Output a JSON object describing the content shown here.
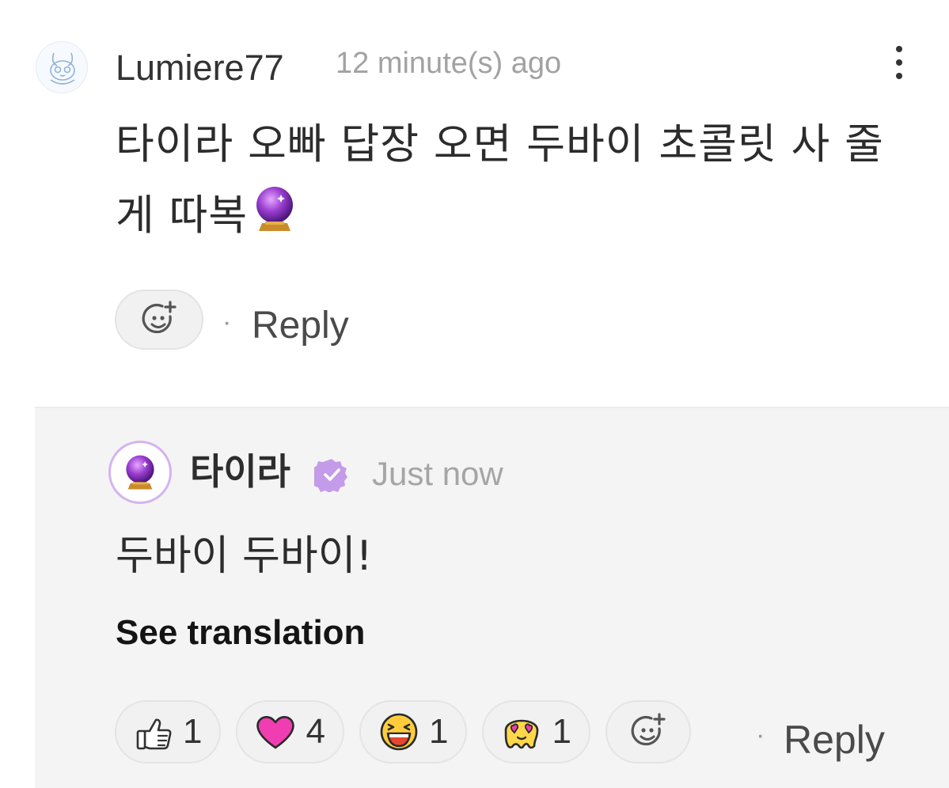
{
  "comment": {
    "username": "Lumiere77",
    "timestamp": "12 minute(s) ago",
    "text": "타이라 오빠 답장 오면 두바이 초콜릿 사 줄게 따복",
    "emoji": "crystal-ball",
    "reply_label": "Reply",
    "separator": "·"
  },
  "reply": {
    "username": "타이라",
    "verified": true,
    "timestamp": "Just now",
    "text": "두바이 두바이!",
    "see_translation": "See translation",
    "reply_label": "Reply",
    "separator": "·",
    "reactions": [
      {
        "icon": "thumbs-up-icon",
        "count": "1"
      },
      {
        "icon": "heart-icon",
        "count": "4"
      },
      {
        "icon": "laughing-face-icon",
        "count": "1"
      },
      {
        "icon": "heart-eyes-melting-face-icon",
        "count": "1"
      }
    ]
  },
  "colors": {
    "panel_background": "#f4f4f4",
    "verified_badge": "#c49be8",
    "heart": "#f03db2",
    "muted_text": "#a2a2a2"
  }
}
